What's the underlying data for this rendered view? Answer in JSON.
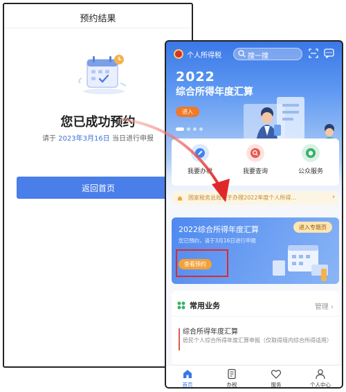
{
  "left_screen": {
    "nav_title": "预约结果",
    "success_title": "您已成功预约",
    "hint_prefix": "请于",
    "hint_date": "2023年3月16日",
    "hint_suffix": "当日进行申报",
    "back_button": "返回首页"
  },
  "right_screen": {
    "app_title": "个人所得税",
    "search_placeholder": "搜一搜",
    "banner": {
      "year": "2022",
      "title": "综合所得年度汇算",
      "enter_button": "进入"
    },
    "services": [
      {
        "label": "我要办税",
        "icon": "pen-icon",
        "color": "#3d86f0"
      },
      {
        "label": "我要查询",
        "icon": "search-icon",
        "color": "#e85a4f"
      },
      {
        "label": "公众服务",
        "icon": "public-service-icon",
        "color": "#37b26a"
      }
    ],
    "notice": "国家税务总局关于办理2022年度个人所得...",
    "annual_card": {
      "title": "2022综合所得年度汇算",
      "subtitle": "您已预约，请于3月16日进行申报",
      "view_button": "查看预约",
      "topic_button": "进入专题页"
    },
    "common": {
      "title": "常用业务",
      "manage": "管理",
      "item_title": "综合所得年度汇算",
      "item_desc": "居民个人综合所得年度汇算申报（仅取得境内综合所得适用）"
    },
    "tabs": [
      {
        "label": "首页",
        "icon": "home-icon",
        "active": true
      },
      {
        "label": "办税",
        "icon": "file-icon",
        "active": false
      },
      {
        "label": "服务",
        "icon": "heart-icon",
        "active": false
      },
      {
        "label": "个人中心",
        "icon": "user-icon",
        "active": false
      }
    ]
  },
  "colors": {
    "primary_blue": "#4a7ee8",
    "highlight_red": "#e0282a",
    "accent_orange": "#ee7a2a"
  }
}
